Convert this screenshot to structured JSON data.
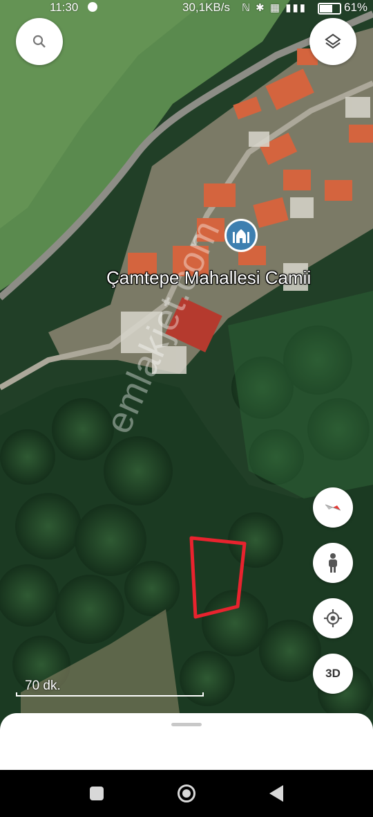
{
  "status_bar": {
    "time": "11:30",
    "network_speed": "30,1KB/s",
    "status_icons": "ℕ ✱ ▦ ▮▮▮",
    "battery_percent": "61%",
    "battery_level": 0.61
  },
  "map": {
    "place_label": "Çamtepe Mahallesi Camii",
    "place_icon": "mosque-icon",
    "watermark": "emlakjet.com",
    "scale_label": "70 dk.",
    "parcel_outline_color": "#e8232e"
  },
  "controls": {
    "search_icon": "search-icon",
    "layers_icon": "layers-icon",
    "compass_icon": "compass-icon",
    "pegman_icon": "pegman-icon",
    "location_icon": "my-location-icon",
    "threed_label": "3D"
  },
  "nav_bar": {
    "recents_icon": "recents-icon",
    "home_icon": "home-icon",
    "back_icon": "back-icon"
  }
}
